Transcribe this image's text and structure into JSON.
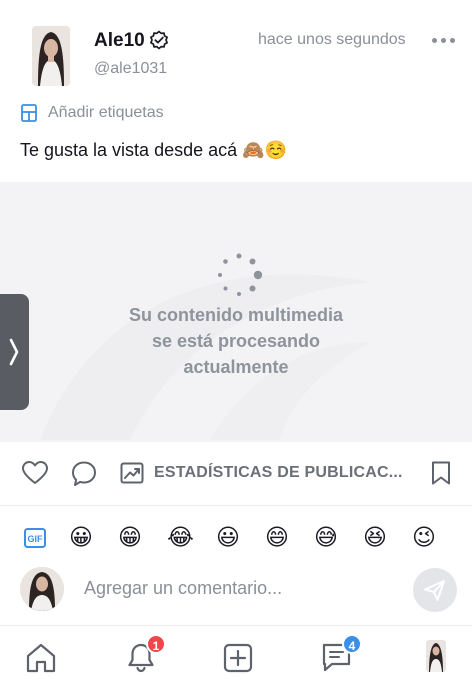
{
  "post": {
    "author_name": "Ale10",
    "handle": "@ale1031",
    "time": "hace unos segundos",
    "add_tags_label": "Añadir etiquetas",
    "caption": "Te gusta la vista desde acá 🙈☺️",
    "media_status": [
      "Su contenido multimedia",
      "se está procesando",
      "actualmente"
    ]
  },
  "actions": {
    "stats_label": "ESTADÍSTICAS DE PUBLICAC..."
  },
  "emoji_bar": {
    "gif_icon": "gif-icon",
    "emojis": [
      "😀",
      "😁",
      "😂",
      "😃",
      "😄",
      "😅",
      "😆",
      "😉"
    ]
  },
  "comment": {
    "placeholder": "Agregar un comentario..."
  },
  "nav": {
    "notifications_badge": "1",
    "messages_badge": "4"
  },
  "colors": {
    "accent_blue": "#3b8fe8",
    "badge_red": "#f0454a",
    "badge_blue": "#3b8fe8",
    "muted_gray": "#8a8f98"
  }
}
